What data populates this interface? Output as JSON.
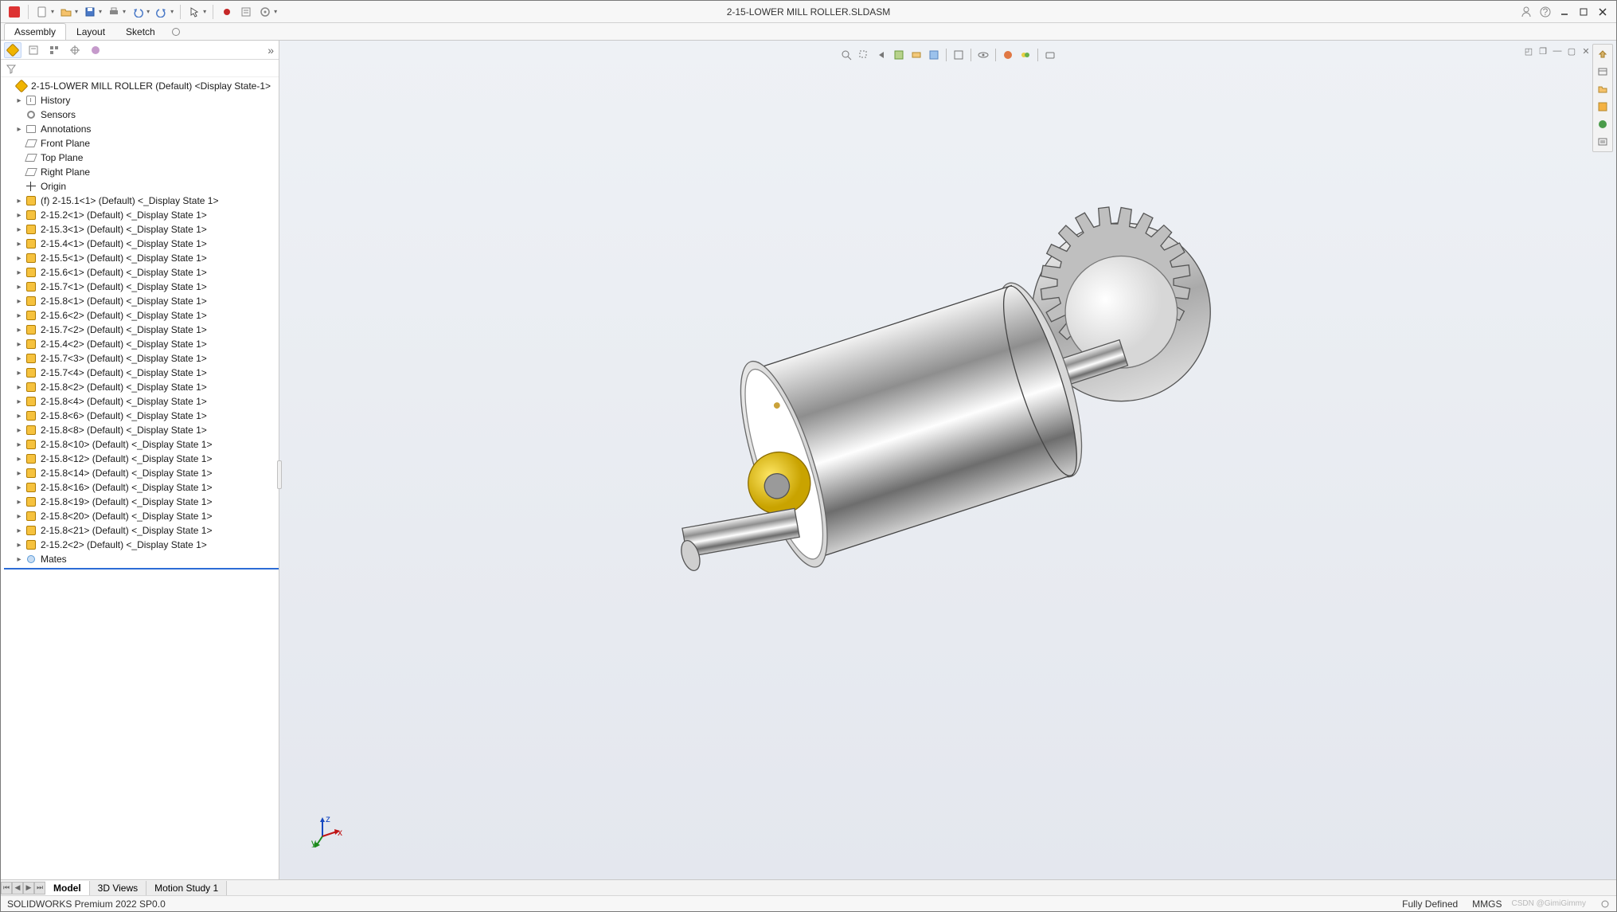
{
  "title": "2-15-LOWER MILL ROLLER.SLDASM",
  "qat": {
    "new": "new-icon",
    "open": "open-icon",
    "save": "save-icon",
    "print": "print-icon",
    "undo": "undo-icon",
    "redo": "redo-icon",
    "select": "select-icon",
    "rebuild": "rebuild-icon",
    "fileprops": "file-properties-icon",
    "options": "options-icon"
  },
  "ribbonTabs": [
    {
      "label": "Assembly",
      "active": true
    },
    {
      "label": "Layout",
      "active": false
    },
    {
      "label": "Sketch",
      "active": false
    }
  ],
  "treeRoot": "2-15-LOWER MILL ROLLER (Default) <Display State-1>",
  "treeFixed": [
    {
      "icon": "history",
      "label": "History",
      "exp": true
    },
    {
      "icon": "sensor",
      "label": "Sensors",
      "exp": false
    },
    {
      "icon": "ann",
      "label": "Annotations",
      "exp": true
    },
    {
      "icon": "plane",
      "label": "Front Plane",
      "exp": false
    },
    {
      "icon": "plane",
      "label": "Top Plane",
      "exp": false
    },
    {
      "icon": "plane",
      "label": "Right Plane",
      "exp": false
    },
    {
      "icon": "origin",
      "label": "Origin",
      "exp": false
    }
  ],
  "treeParts": [
    "(f) 2-15.1<1> (Default) <<Default>_Display State 1>",
    "2-15.2<1> (Default) <<Default>_Display State 1>",
    "2-15.3<1> (Default) <<Default>_Display State 1>",
    "2-15.4<1> (Default) <<Default>_Display State 1>",
    "2-15.5<1> (Default) <<Default>_Display State 1>",
    "2-15.6<1> (Default) <<Default>_Display State 1>",
    "2-15.7<1> (Default) <<Default>_Display State 1>",
    "2-15.8<1> (Default) <<Default>_Display State 1>",
    "2-15.6<2> (Default) <<Default>_Display State 1>",
    "2-15.7<2> (Default) <<Default>_Display State 1>",
    "2-15.4<2> (Default) <<Default>_Display State 1>",
    "2-15.7<3> (Default) <<Default>_Display State 1>",
    "2-15.7<4> (Default) <<Default>_Display State 1>",
    "2-15.8<2> (Default) <<Default>_Display State 1>",
    "2-15.8<4> (Default) <<Default>_Display State 1>",
    "2-15.8<6> (Default) <<Default>_Display State 1>",
    "2-15.8<8> (Default) <<Default>_Display State 1>",
    "2-15.8<10> (Default) <<Default>_Display State 1>",
    "2-15.8<12> (Default) <<Default>_Display State 1>",
    "2-15.8<14> (Default) <<Default>_Display State 1>",
    "2-15.8<16> (Default) <<Default>_Display State 1>",
    "2-15.8<19> (Default) <<Default>_Display State 1>",
    "2-15.8<20> (Default) <<Default>_Display State 1>",
    "2-15.8<21> (Default) <<Default>_Display State 1>",
    "2-15.2<2> (Default) <<Default>_Display State 1>"
  ],
  "treeMates": "Mates",
  "bottomTabs": [
    {
      "label": "Model",
      "active": true
    },
    {
      "label": "3D Views",
      "active": false
    },
    {
      "label": "Motion Study 1",
      "active": false
    }
  ],
  "status": {
    "product": "SOLIDWORKS Premium 2022 SP0.0",
    "defined": "Fully Defined",
    "units": "MMGS",
    "watermark": "CSDN @GimiGimmy"
  },
  "triad": {
    "x": "x",
    "y": "y",
    "z": "z"
  }
}
